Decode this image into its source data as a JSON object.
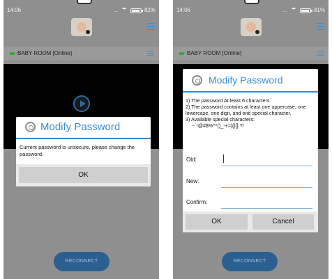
{
  "left_screen": {
    "status": {
      "time": "14:06",
      "signal": "...",
      "battery": "82%"
    },
    "device": {
      "name": "BABY ROOM [Online]"
    },
    "dialog": {
      "title": "Modify Password",
      "message": "Current password is unsecure, please change the password.",
      "ok_label": "OK"
    },
    "reconnect_label": "RECONNECT"
  },
  "right_screen": {
    "status": {
      "time": "14:06",
      "signal": "...",
      "battery": "81%"
    },
    "device": {
      "name": "BABY ROOM [Online]"
    },
    "dialog": {
      "title": "Modify Password",
      "rule1": "1) The password At least 6 characters.",
      "rule2": "2) The password contains at least one uppercase, one lowercase, one digit, and one special character.",
      "rule3": "3) Available special characters:",
      "special_chars": "~`!@#$%^*()_-+=|{}[].?/",
      "fields": [
        {
          "label": "Old:",
          "value": ""
        },
        {
          "label": "New:",
          "value": ""
        },
        {
          "label": "Confirm:",
          "value": ""
        }
      ],
      "ok_label": "OK",
      "cancel_label": "Cancel"
    },
    "reconnect_label": "RECONNECT"
  },
  "colors": {
    "accent": "#3a8fd2",
    "button_blue": "#2b5f8f",
    "online_green": "#39a53a",
    "dim_overlay": "#8f8f8f"
  },
  "icons": [
    "wifi-icon",
    "battery-icon",
    "avatar-icon",
    "menu-icon",
    "settings-icon",
    "play-icon",
    "lock-dialog-icon"
  ]
}
